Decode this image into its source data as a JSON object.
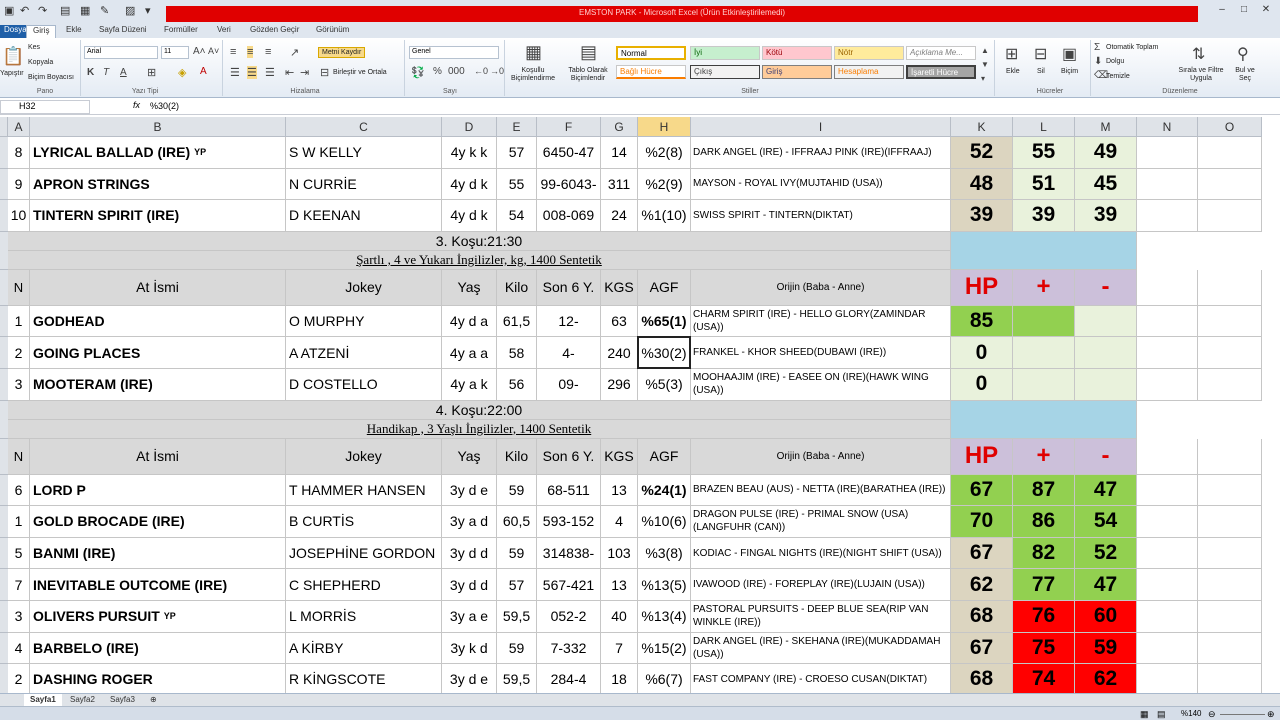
{
  "window": {
    "title": "EMSTON PARK - Microsoft Excel (Ürün Etkinleştirilemedi)"
  },
  "tabs": [
    "Giriş",
    "Ekle",
    "Sayfa Düzeni",
    "Formüller",
    "Veri",
    "Gözden Geçir",
    "Görünüm"
  ],
  "file_tab": "Dosya",
  "ribbon": {
    "clipboard": {
      "cut": "Kes",
      "copy": "Kopyala",
      "painter": "Biçim Boyacısı",
      "paste": "Yapıştır",
      "group": "Pano"
    },
    "font": {
      "name": "Arial",
      "size": "11",
      "group": "Yazı Tipi"
    },
    "alignment": {
      "wrap": "Metni Kaydır",
      "merge": "Birleştir ve Ortala",
      "group": "Hizalama"
    },
    "number": {
      "format": "Genel",
      "group": "Sayı"
    },
    "styles": {
      "conditional": "Koşullu Biçimlendirme",
      "table": "Tablo Olarak Biçimlendir",
      "cell_styles": [
        "Normal",
        "İyi",
        "Kötü",
        "Nötr",
        "Açıklama Me...",
        "Bağlı Hücre",
        "Çıkış",
        "Giriş",
        "Hesaplama",
        "İşaretli Hücre"
      ],
      "group": "Stiller"
    },
    "cells": {
      "insert": "Ekle",
      "delete": "Sil",
      "format": "Biçim",
      "group": "Hücreler"
    },
    "editing": {
      "autosum": "Otomatik Toplam",
      "fill": "Dolgu",
      "clear": "Temizle",
      "sort": "Sırala ve Filtre Uygula",
      "find": "Bul ve Seç",
      "group": "Düzenleme"
    }
  },
  "formula_bar": {
    "name_box": "H32",
    "fx": "fx",
    "value": "%30(2)"
  },
  "columns": [
    "A",
    "B",
    "C",
    "D",
    "E",
    "F",
    "G",
    "H",
    "I",
    "K",
    "L",
    "M",
    "N",
    "O"
  ],
  "header_labels": {
    "n": "N",
    "name": "At İsmi",
    "jockey": "Jokey",
    "age": "Yaş",
    "kilo": "Kilo",
    "son6": "Son 6 Y.",
    "kgs": "KGS",
    "agf": "AGF",
    "orijin": "Orijin (Baba - Anne)",
    "hp": "HP",
    "plus": "+",
    "minus": "-"
  },
  "race3": {
    "title": "3. Koşu:21:30",
    "subtitle": "Şartlı , 4 ve Yukarı İngilizler, kg, 1400 Sentetik"
  },
  "race4": {
    "title": "4. Koşu:22:00",
    "subtitle": "Handikap , 3 Yaşlı İngilizler, 1400 Sentetik"
  },
  "rows_top": [
    {
      "n": "8",
      "name": "LYRICAL BALLAD (IRE)",
      "sup": "YP",
      "jockey": "S W KELLY",
      "age": "4y k k",
      "kilo": "57",
      "son6": "6450-47",
      "kgs": "14",
      "agf": "%2(8)",
      "orijin": "DARK ANGEL (IRE) - IFFRAAJ PINK (IRE)(IFFRAAJ)",
      "hp": "52",
      "plus": "55",
      "minus": "49"
    },
    {
      "n": "9",
      "name": "APRON STRINGS",
      "sup": "",
      "jockey": "N CURRİE",
      "age": "4y d k",
      "kilo": "55",
      "son6": "99-6043-",
      "kgs": "311",
      "agf": "%2(9)",
      "orijin": "MAYSON - ROYAL IVY(MUJTAHID (USA))",
      "hp": "48",
      "plus": "51",
      "minus": "45"
    },
    {
      "n": "10",
      "name": "TINTERN SPIRIT (IRE)",
      "sup": "",
      "jockey": "D KEENAN",
      "age": "4y d k",
      "kilo": "54",
      "son6": "008-069",
      "kgs": "24",
      "agf": "%1(10)",
      "orijin": "SWISS SPIRIT - TINTERN(DIKTAT)",
      "hp": "39",
      "plus": "39",
      "minus": "39"
    }
  ],
  "rows_race3": [
    {
      "n": "1",
      "name": "GODHEAD",
      "sup": "",
      "jockey": "O MURPHY",
      "age": "4y d a",
      "kilo": "61,5",
      "son6": "12-",
      "kgs": "63",
      "agf": "%65(1)",
      "orijin": "CHARM SPIRIT (IRE) - HELLO GLORY(ZAMINDAR (USA))",
      "hp": "85",
      "plus": "",
      "minus": ""
    },
    {
      "n": "2",
      "name": "GOING PLACES",
      "sup": "",
      "jockey": "A ATZENİ",
      "age": "4y a a",
      "kilo": "58",
      "son6": "4-",
      "kgs": "240",
      "agf": "%30(2)",
      "orijin": "FRANKEL - KHOR SHEED(DUBAWI (IRE))",
      "hp": "0",
      "plus": "",
      "minus": ""
    },
    {
      "n": "3",
      "name": "MOOTERAM (IRE)",
      "sup": "",
      "jockey": "D COSTELLO",
      "age": "4y a k",
      "kilo": "56",
      "son6": "09-",
      "kgs": "296",
      "agf": "%5(3)",
      "orijin": "MOOHAAJIM (IRE) - EASEE ON (IRE)(HAWK WING (USA))",
      "hp": "0",
      "plus": "",
      "minus": ""
    }
  ],
  "rows_race4": [
    {
      "n": "6",
      "name": "LORD P",
      "sup": "",
      "jockey": "T HAMMER HANSEN",
      "age": "3y d e",
      "kilo": "59",
      "son6": "68-511",
      "kgs": "13",
      "agf": "%24(1)",
      "orijin": "BRAZEN BEAU (AUS) - NETTA (IRE)(BARATHEA (IRE))",
      "hp": "67",
      "plus": "87",
      "minus": "47"
    },
    {
      "n": "1",
      "name": "GOLD BROCADE (IRE)",
      "sup": "",
      "jockey": "B CURTİS",
      "age": "3y a d",
      "kilo": "60,5",
      "son6": "593-152",
      "kgs": "4",
      "agf": "%10(6)",
      "orijin": "DRAGON PULSE (IRE) - PRIMAL SNOW (USA)(LANGFUHR (CAN))",
      "hp": "70",
      "plus": "86",
      "minus": "54"
    },
    {
      "n": "5",
      "name": "BANMI (IRE)",
      "sup": "",
      "jockey": "JOSEPHİNE GORDON",
      "age": "3y d d",
      "kilo": "59",
      "son6": "314838-",
      "kgs": "103",
      "agf": "%3(8)",
      "orijin": "KODIAC - FINGAL NIGHTS (IRE)(NIGHT SHIFT (USA))",
      "hp": "67",
      "plus": "82",
      "minus": "52"
    },
    {
      "n": "7",
      "name": "INEVITABLE OUTCOME (IRE)",
      "sup": "",
      "jockey": "C SHEPHERD",
      "age": "3y d d",
      "kilo": "57",
      "son6": "567-421",
      "kgs": "13",
      "agf": "%13(5)",
      "orijin": "IVAWOOD (IRE) - FOREPLAY (IRE)(LUJAIN (USA))",
      "hp": "62",
      "plus": "77",
      "minus": "47"
    },
    {
      "n": "3",
      "name": "OLIVERS PURSUIT",
      "sup": "YP",
      "jockey": "L MORRİS",
      "age": "3y a e",
      "kilo": "59,5",
      "son6": "052-2",
      "kgs": "40",
      "agf": "%13(4)",
      "orijin": "PASTORAL PURSUITS - DEEP BLUE SEA(RIP VAN WINKLE (IRE))",
      "hp": "68",
      "plus": "76",
      "minus": "60"
    },
    {
      "n": "4",
      "name": "BARBELO (IRE)",
      "sup": "",
      "jockey": "A KİRBY",
      "age": "3y k d",
      "kilo": "59",
      "son6": "7-332",
      "kgs": "7",
      "agf": "%15(2)",
      "orijin": "DARK ANGEL (IRE) - SKEHANA (IRE)(MUKADDAMAH (USA))",
      "hp": "67",
      "plus": "75",
      "minus": "59"
    },
    {
      "n": "2",
      "name": "DASHING ROGER",
      "sup": "",
      "jockey": "R KİNGSCOTE",
      "age": "3y d e",
      "kilo": "59,5",
      "son6": "284-4",
      "kgs": "18",
      "agf": "%6(7)",
      "orijin": "FAST COMPANY (IRE) - CROESO CUSAN(DIKTAT)",
      "hp": "68",
      "plus": "74",
      "minus": "62"
    }
  ],
  "sheets": [
    "Sayfa1",
    "Sayfa2",
    "Sayfa3"
  ],
  "status": {
    "zoom": "%140"
  },
  "colors": {
    "green": "#92d050",
    "red": "#ff0000",
    "blue": "#a6d4e6",
    "tan": "#dcd5c0",
    "lavender": "#ccc0da",
    "hp_red": "#e00000"
  }
}
